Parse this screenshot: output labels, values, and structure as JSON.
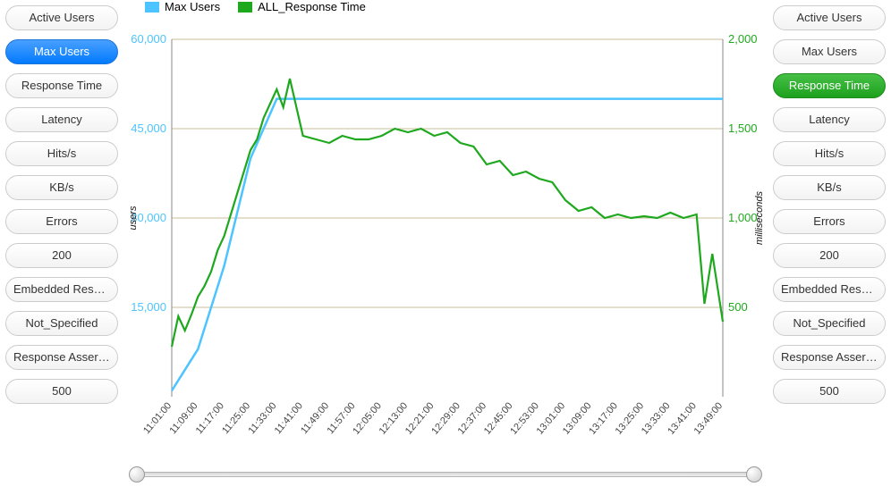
{
  "left_buttons": [
    {
      "id": "active-users",
      "label": "Active Users",
      "state": ""
    },
    {
      "id": "max-users",
      "label": "Max Users",
      "state": "active-blue"
    },
    {
      "id": "response-time",
      "label": "Response Time",
      "state": ""
    },
    {
      "id": "latency",
      "label": "Latency",
      "state": ""
    },
    {
      "id": "hits-s",
      "label": "Hits/s",
      "state": ""
    },
    {
      "id": "kb-s",
      "label": "KB/s",
      "state": ""
    },
    {
      "id": "errors",
      "label": "Errors",
      "state": ""
    },
    {
      "id": "200",
      "label": "200",
      "state": ""
    },
    {
      "id": "embedded-resource",
      "label": "Embedded Resour...",
      "state": ""
    },
    {
      "id": "not-specified",
      "label": "Not_Specified",
      "state": ""
    },
    {
      "id": "response-assertion",
      "label": "Response Assertion",
      "state": ""
    },
    {
      "id": "500",
      "label": "500",
      "state": ""
    }
  ],
  "right_buttons": [
    {
      "id": "active-users",
      "label": "Active Users",
      "state": ""
    },
    {
      "id": "max-users",
      "label": "Max Users",
      "state": ""
    },
    {
      "id": "response-time",
      "label": "Response Time",
      "state": "active-green"
    },
    {
      "id": "latency",
      "label": "Latency",
      "state": ""
    },
    {
      "id": "hits-s",
      "label": "Hits/s",
      "state": ""
    },
    {
      "id": "kb-s",
      "label": "KB/s",
      "state": ""
    },
    {
      "id": "errors",
      "label": "Errors",
      "state": ""
    },
    {
      "id": "200",
      "label": "200",
      "state": ""
    },
    {
      "id": "embedded-resource",
      "label": "Embedded Resour...",
      "state": ""
    },
    {
      "id": "not-specified",
      "label": "Not_Specified",
      "state": ""
    },
    {
      "id": "response-assertion",
      "label": "Response Assertion",
      "state": ""
    },
    {
      "id": "500",
      "label": "500",
      "state": ""
    }
  ],
  "legend": {
    "series1": "Max Users",
    "series2": "ALL_Response Time"
  },
  "axis_labels": {
    "left": "users",
    "right": "milliseconds"
  },
  "colors": {
    "series1": "#4dc4ff",
    "series2": "#1ea81e",
    "grid": "#b8a67a"
  },
  "chart_data": {
    "type": "line",
    "x": [
      "11:01:00",
      "11:09:00",
      "11:17:00",
      "11:25:00",
      "11:33:00",
      "11:41:00",
      "11:49:00",
      "11:57:00",
      "12:05:00",
      "12:13:00",
      "12:21:00",
      "12:29:00",
      "12:37:00",
      "12:45:00",
      "12:53:00",
      "13:01:00",
      "13:09:00",
      "13:17:00",
      "13:25:00",
      "13:33:00",
      "13:41:00",
      "13:49:00"
    ],
    "left_axis": {
      "label": "users",
      "ticks": [
        15000,
        30000,
        45000,
        60000
      ],
      "tick_labels": [
        "15,000",
        "30,000",
        "45,000",
        "60,000"
      ],
      "min": 0,
      "max": 60000
    },
    "right_axis": {
      "label": "milliseconds",
      "ticks": [
        500,
        1000,
        1500,
        2000
      ],
      "tick_labels": [
        "500",
        "1,000",
        "1,500",
        "2,000"
      ],
      "min": 0,
      "max": 2000
    },
    "series": [
      {
        "name": "Max Users",
        "axis": "left",
        "color": "#4dc4ff",
        "values": [
          1000,
          8000,
          22000,
          40000,
          50000,
          50000,
          50000,
          50000,
          50000,
          50000,
          50000,
          50000,
          50000,
          50000,
          50000,
          50000,
          50000,
          50000,
          50000,
          50000,
          50000,
          50000
        ]
      },
      {
        "name": "ALL_Response Time",
        "axis": "right",
        "color": "#1ea81e",
        "detail_x": [
          0,
          0.25,
          0.5,
          0.75,
          1,
          1.25,
          1.5,
          1.75,
          2,
          2.25,
          2.5,
          2.75,
          3,
          3.25,
          3.5,
          3.75,
          4,
          4.25,
          4.5,
          5,
          5.5,
          6,
          6.5,
          7,
          7.5,
          8,
          8.5,
          9,
          9.5,
          10,
          10.5,
          11,
          11.5,
          12,
          12.5,
          13,
          13.5,
          14,
          14.5,
          15,
          15.5,
          16,
          16.5,
          17,
          17.5,
          18,
          18.5,
          19,
          19.5,
          20,
          20.3,
          20.6,
          21
        ],
        "detail_y": [
          280,
          450,
          370,
          460,
          560,
          620,
          700,
          820,
          900,
          1020,
          1140,
          1260,
          1380,
          1440,
          1560,
          1640,
          1720,
          1620,
          1780,
          1460,
          1440,
          1420,
          1460,
          1440,
          1440,
          1460,
          1500,
          1480,
          1500,
          1460,
          1480,
          1420,
          1400,
          1300,
          1320,
          1240,
          1260,
          1220,
          1200,
          1100,
          1040,
          1060,
          1000,
          1020,
          1000,
          1010,
          1000,
          1030,
          1000,
          1020,
          520,
          800,
          420
        ]
      }
    ]
  }
}
